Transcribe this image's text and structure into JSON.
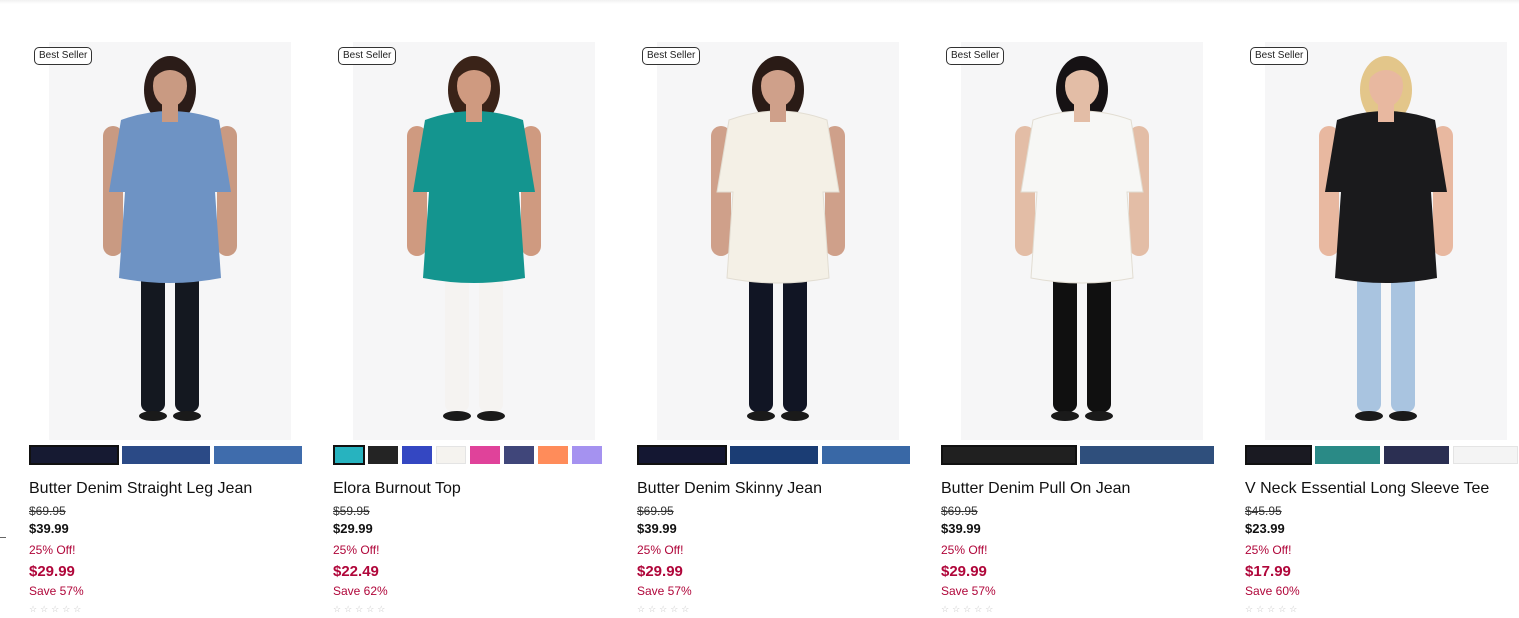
{
  "products": [
    {
      "badge": "Best Seller",
      "name": "Butter Denim Straight Leg Jean",
      "original_price": "$69.95",
      "current_price": "$39.99",
      "discount_note": "25% Off!",
      "sale_price": "$29.99",
      "save_text": "Save 57%",
      "rating": "☆☆☆☆☆",
      "top_color": "#6e93c4",
      "bottom_color": "#141820",
      "skin": "#c99a82",
      "hair": "#2b1c18",
      "swatches": [
        {
          "color": "#161a32",
          "selected": true
        },
        {
          "color": "#2b4a86",
          "selected": false
        },
        {
          "color": "#3f6cac",
          "selected": false
        }
      ]
    },
    {
      "badge": "Best Seller",
      "name": "Elora Burnout Top",
      "original_price": "$59.95",
      "current_price": "$29.99",
      "discount_note": "25% Off!",
      "sale_price": "$22.49",
      "save_text": "Save 62%",
      "rating": "☆☆☆☆☆",
      "top_color": "#14958f",
      "bottom_color": "#f5f3f1",
      "skin": "#cf9a80",
      "hair": "#3a2318",
      "swatches": [
        {
          "color": "#27b3bf",
          "selected": true
        },
        {
          "color": "#242424",
          "selected": false
        },
        {
          "color": "#3447c2",
          "selected": false
        },
        {
          "color": "#f5f3ef",
          "selected": false
        },
        {
          "color": "#e0429a",
          "selected": false
        },
        {
          "color": "#40467a",
          "selected": false
        },
        {
          "color": "#ff8c5a",
          "selected": false
        },
        {
          "color": "#a592f0",
          "selected": false
        }
      ]
    },
    {
      "badge": "Best Seller",
      "name": "Butter Denim Skinny Jean",
      "original_price": "$69.95",
      "current_price": "$39.99",
      "discount_note": "25% Off!",
      "sale_price": "$29.99",
      "save_text": "Save 57%",
      "rating": "☆☆☆☆☆",
      "top_color": "#f4f0e6",
      "bottom_color": "#111524",
      "skin": "#cfa08a",
      "hair": "#2a1b16",
      "swatches": [
        {
          "color": "#141732",
          "selected": true
        },
        {
          "color": "#1b3d74",
          "selected": false
        },
        {
          "color": "#3968a6",
          "selected": false
        }
      ]
    },
    {
      "badge": "Best Seller",
      "name": "Butter Denim Pull On Jean",
      "original_price": "$69.95",
      "current_price": "$39.99",
      "discount_note": "25% Off!",
      "sale_price": "$29.99",
      "save_text": "Save 57%",
      "rating": "☆☆☆☆☆",
      "top_color": "#f7f7f5",
      "bottom_color": "#101010",
      "skin": "#e3bda6",
      "hair": "#161214",
      "swatches": [
        {
          "color": "#202020",
          "selected": true
        },
        {
          "color": "#2f4f7c",
          "selected": false
        }
      ]
    },
    {
      "badge": "Best Seller",
      "name": "V Neck Essential Long Sleeve Tee",
      "original_price": "$45.95",
      "current_price": "$23.99",
      "discount_note": "25% Off!",
      "sale_price": "$17.99",
      "save_text": "Save 60%",
      "rating": "☆☆☆☆☆",
      "top_color": "#1a1a1c",
      "bottom_color": "#a9c4e0",
      "skin": "#e8b8a0",
      "hair": "#e3c68a",
      "swatches": [
        {
          "color": "#1a1a22",
          "selected": true
        },
        {
          "color": "#2a8a86",
          "selected": false
        },
        {
          "color": "#2b2f52",
          "selected": false
        },
        {
          "color": "#f4f4f4",
          "selected": false
        }
      ]
    }
  ]
}
